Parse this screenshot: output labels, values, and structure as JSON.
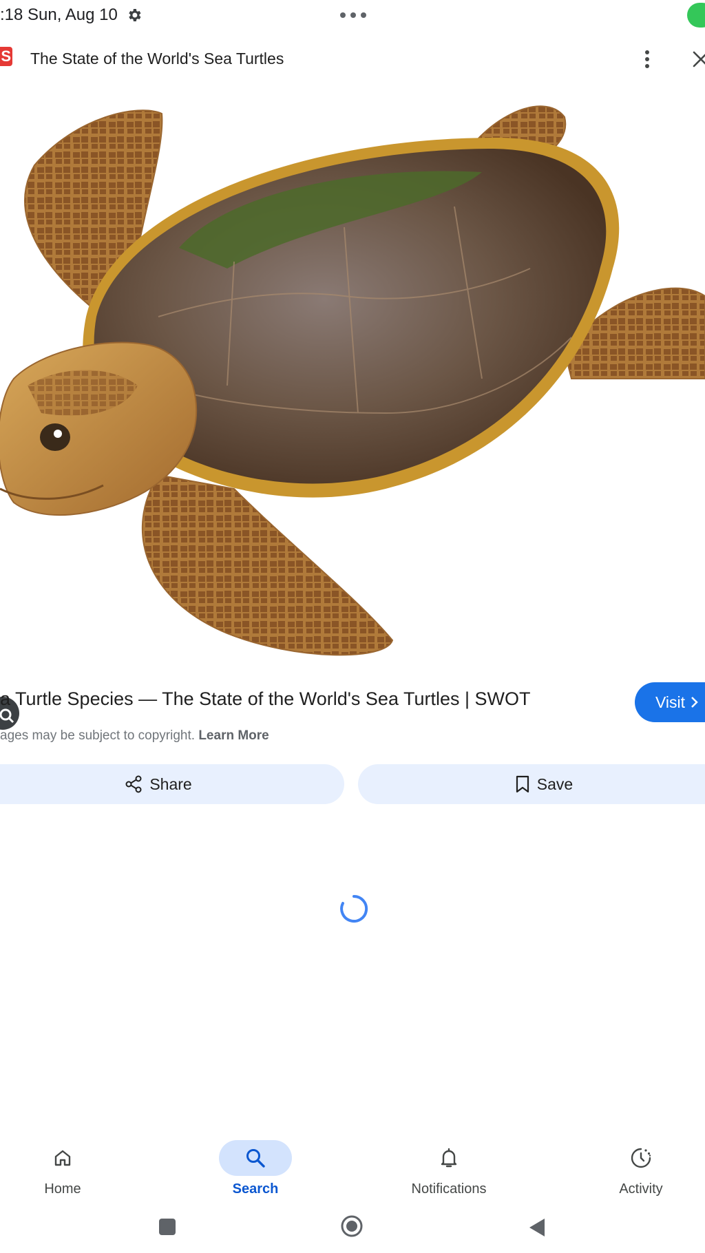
{
  "status_bar": {
    "time_date": ":18  Sun, Aug 10",
    "settings_icon": "gear-icon",
    "menu_icon": "more-horizontal-icon"
  },
  "title_bar": {
    "site_icon_letter": "S",
    "title": "The State of the World's Sea Turtles",
    "menu_icon": "more-vertical-icon",
    "close_icon": "close-icon"
  },
  "image": {
    "subject": "sea-turtle-illustration",
    "lens_icon": "lens-search-icon"
  },
  "result": {
    "heading": "a Turtle Species — The State of the World's Sea Turtles | SWOT",
    "visit_label": "Visit",
    "copyright_text": "ages may be subject to copyright.",
    "learn_more": "Learn More"
  },
  "actions": {
    "share_label": "Share",
    "save_label": "Save"
  },
  "bottom_nav": {
    "items": [
      {
        "label": "Home",
        "icon": "home-icon"
      },
      {
        "label": "Search",
        "icon": "search-icon",
        "active": true
      },
      {
        "label": "Notifications",
        "icon": "bell-icon"
      },
      {
        "label": "Activity",
        "icon": "activity-icon"
      }
    ]
  },
  "colors": {
    "accent": "#1a73e8",
    "chip_bg": "#e8f0fe",
    "nav_active_bg": "#d3e3fd",
    "nav_active_text": "#0b57d0"
  }
}
